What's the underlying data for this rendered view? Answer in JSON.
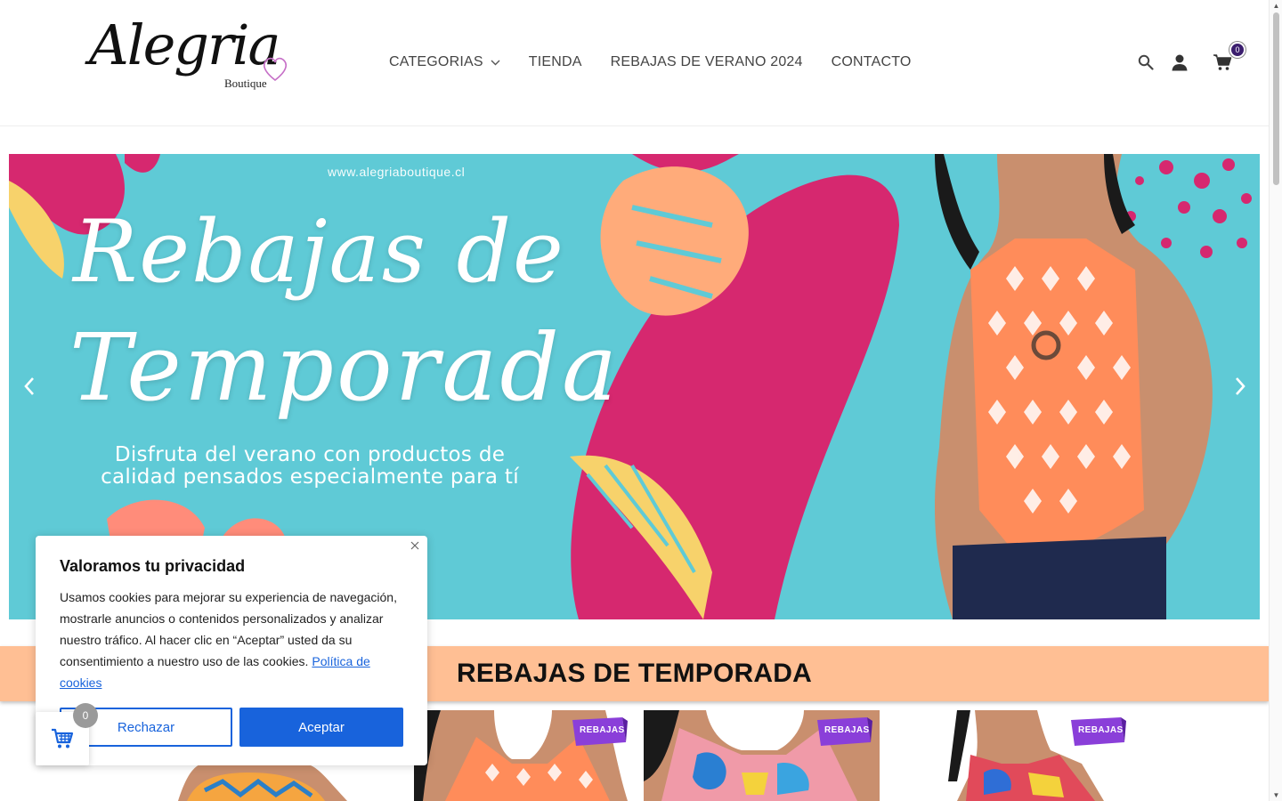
{
  "brand": {
    "logo_script": "Alegria",
    "logo_sub": "Boutique"
  },
  "nav": {
    "items": [
      {
        "label": "CATEGORIAS",
        "has_dropdown": true
      },
      {
        "label": "TIENDA"
      },
      {
        "label": "REBAJAS DE VERANO 2024"
      },
      {
        "label": "CONTACTO"
      }
    ]
  },
  "header_icons": {
    "search": "search-icon",
    "account": "user-icon",
    "cart": "cart-icon",
    "cart_count": "0"
  },
  "hero": {
    "url": "www.alegriaboutique.cl",
    "headline_line1": "Rebajas de",
    "headline_line2": "Temporada",
    "tagline": "Disfruta del verano con productos de calidad  pensados especialmente para tí",
    "prev_icon": "chevron-left-icon",
    "next_icon": "chevron-right-icon"
  },
  "section": {
    "title": "REBAJAS DE TEMPORADA"
  },
  "products": [
    {
      "badge": ""
    },
    {
      "badge": "REBAJAS"
    },
    {
      "badge": "REBAJAS"
    },
    {
      "badge": "REBAJAS"
    }
  ],
  "cookie_banner": {
    "title": "Valoramos tu privacidad",
    "body": "Usamos cookies para mejorar su experiencia de navegación, mostrarle anuncios o contenidos personalizados y analizar nuestro tráfico. Al hacer clic en “Aceptar” usted da su consentimiento a nuestro uso de las cookies.",
    "policy_link": "Política de cookies",
    "reject_label": "Rechazar",
    "accept_label": "Aceptar"
  },
  "floating_cart": {
    "count": "0"
  },
  "colors": {
    "hero_bg": "#5fcad6",
    "magenta": "#d6286f",
    "peach": "#ffbf94",
    "accent_blue": "#1863dc",
    "cart_badge": "#3b1e6e"
  }
}
